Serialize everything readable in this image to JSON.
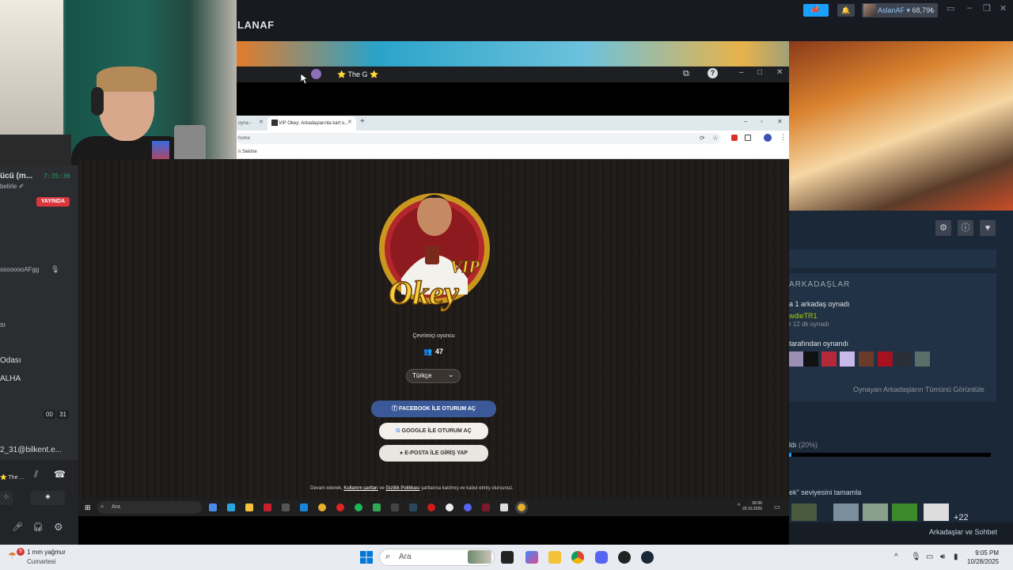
{
  "steam": {
    "window_title": "LANAF",
    "user_name": "AslanAF",
    "user_balance": "68,79₺",
    "friends_heading": "ARKADAŞLAR",
    "friends_played_recent": "a 1 arkadaş oynadı",
    "friend_name": "wdieTR1",
    "friend_time": "r 12 dk oynadı",
    "friends_played_by": "tarafından oynandı",
    "friends_view_all": "Oynayan Arkadaşların Tümünü Görüntüle",
    "achievement_progress": "ldı",
    "achievement_percent": "(20%)",
    "achievement_progress_value": 0.2,
    "achievement_text": "ek\" seviyesini tamamla",
    "achievement_more": "+22",
    "friends_chat": "Arkadaşlar ve Sohbet"
  },
  "discord": {
    "channel_partial": "ücü (m...",
    "channel_sub": "belirle ✐",
    "stream_time": "7:35:36",
    "live_badge": "YAYINDA",
    "member_1": "ssoooooAFgg",
    "member_2": "sı",
    "room_name": "Odası",
    "member_3": "ALHA",
    "counter_a": "00",
    "counter_b": "31",
    "email_partial": "2_31@bilkent.e...",
    "voice_user": "⭐ The ...",
    "stream_title": "⭐ The G ⭐"
  },
  "chrome": {
    "tab_prev": "oyna -",
    "tab_active": "VIP Okey: Arkadaşlarınla kart o...",
    "address": "home",
    "bookmark": "n Sekme"
  },
  "okey": {
    "logo_word_vip": "VIP",
    "logo_word_okey": "Okey",
    "online_label": "Çevrimiçi oyuncu",
    "online_count": "47",
    "language": "Türkçe",
    "facebook_login": "FACEBOOK İLE OTURUM AÇ",
    "google_login": "GOOGLE İLE OTURUM AÇ",
    "email_login": "E-POSTA İLE GİRİŞ YAP",
    "terms_prefix": "Devam ederek,",
    "terms_link1": "Kullanım şartları",
    "terms_mid": "ve",
    "terms_link2": "Gizlilik Politikası",
    "terms_suffix": "şartlarına katılmış ve kabul etmiş olursunuz."
  },
  "inner_taskbar": {
    "search": "Ara",
    "time": "00:06",
    "date": "29.10.2025"
  },
  "taskbar": {
    "weather_badge": "9",
    "weather_temp": "1 mm yağmur",
    "weather_day": "Cumartesi",
    "search": "Ara",
    "time": "9:05 PM",
    "date": "10/28/2025"
  }
}
